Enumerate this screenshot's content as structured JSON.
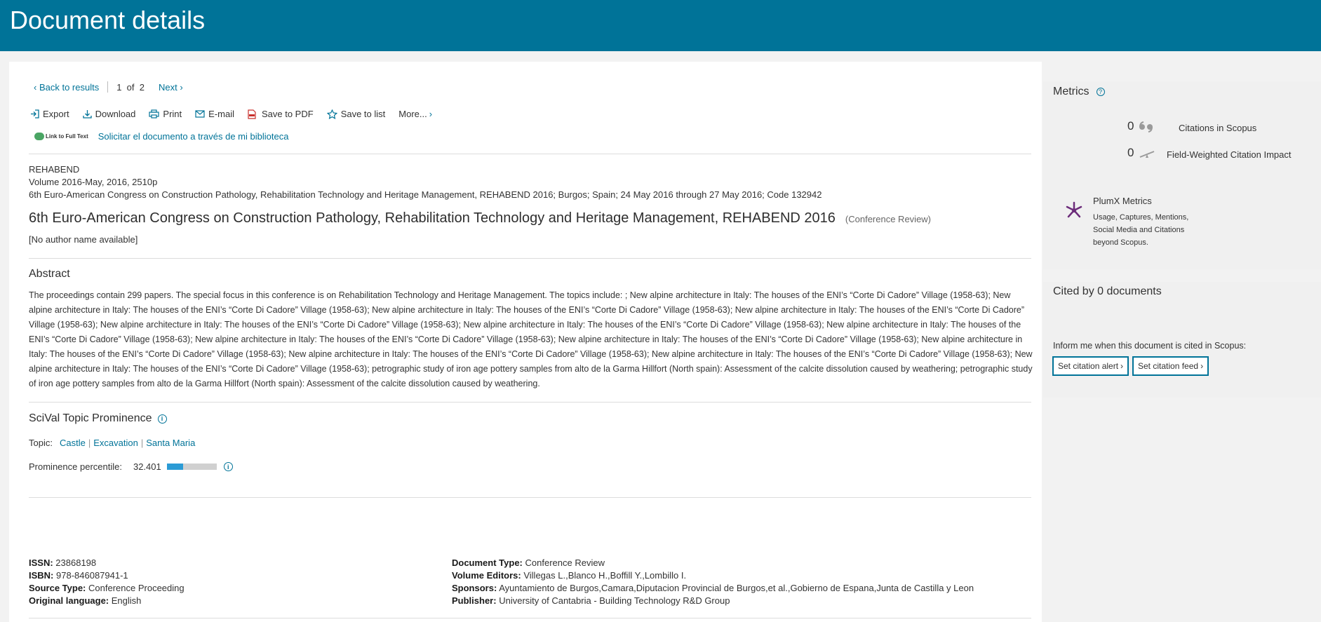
{
  "header": {
    "title": "Document details"
  },
  "nav": {
    "back": "Back to results",
    "pager": "1  of  2",
    "next": "Next"
  },
  "toolbar": {
    "export": "Export",
    "download": "Download",
    "print": "Print",
    "email": "E-mail",
    "pdf": "Save to PDF",
    "save_list": "Save to list",
    "more": "More..."
  },
  "linkrow": {
    "sfx_badge": "Link to Full Text",
    "library_link": "Solicitar el documento a través de mi biblioteca"
  },
  "source": {
    "journal": "REHABEND",
    "volume": "Volume 2016-May, 2016, 2510p",
    "conference": "6th Euro-American Congress on Construction Pathology, Rehabilitation Technology and Heritage Management, REHABEND 2016; Burgos; Spain; 24 May 2016 through 27 May 2016; Code 132942"
  },
  "document": {
    "title": "6th Euro-American Congress on Construction Pathology, Rehabilitation Technology and Heritage Management, REHABEND 2016",
    "type": "(Conference Review)",
    "authors": "[No author name available]"
  },
  "abstract": {
    "heading": "Abstract",
    "text": "The proceedings contain 299 papers. The special focus in this conference is on Rehabilitation Technology and Heritage Management. The topics include: ; New alpine architecture in Italy: The houses of the ENI’s “Corte Di Cadore” Village (1958-63); New alpine architecture in Italy: The houses of the ENI’s “Corte Di Cadore” Village (1958-63); New alpine architecture in Italy: The houses of the ENI’s “Corte Di Cadore” Village (1958-63); New alpine architecture in Italy: The houses of the ENI’s “Corte Di Cadore” Village (1958-63); New alpine architecture in Italy: The houses of the ENI’s “Corte Di Cadore” Village (1958-63); New alpine architecture in Italy: The houses of the ENI’s “Corte Di Cadore” Village (1958-63); New alpine architecture in Italy: The houses of the ENI’s “Corte Di Cadore” Village (1958-63); New alpine architecture in Italy: The houses of the ENI’s “Corte Di Cadore” Village (1958-63); New alpine architecture in Italy: The houses of the ENI’s “Corte Di Cadore” Village (1958-63); New alpine architecture in Italy: The houses of the ENI’s “Corte Di Cadore” Village (1958-63); New alpine architecture in Italy: The houses of the ENI’s “Corte Di Cadore” Village (1958-63); New alpine architecture in Italy: The houses of the ENI’s “Corte Di Cadore” Village (1958-63); New alpine architecture in Italy: The houses of the ENI’s “Corte Di Cadore” Village (1958-63); petrographic study of iron age pottery samples from alto de la Garma Hillfort (North spain): Assessment of the calcite dissolution caused by weathering; petrographic study of iron age pottery samples from alto de la Garma Hillfort (North spain): Assessment of the calcite dissolution caused by weathering."
  },
  "scival": {
    "heading": "SciVal Topic Prominence",
    "topic_label": "Topic:",
    "topics": [
      "Castle",
      "Excavation",
      "Santa Maria"
    ],
    "prominence_label": "Prominence percentile:",
    "prominence_value": "32.401",
    "prominence_fraction": 0.324
  },
  "biblio": {
    "issn_label": "ISSN:",
    "issn": "23868198",
    "isbn_label": "ISBN:",
    "isbn": "978-846087941-1",
    "source_type_label": "Source Type:",
    "source_type": "Conference Proceeding",
    "language_label": "Original language:",
    "language": "English",
    "doc_type_label": "Document Type:",
    "doc_type": "Conference Review",
    "editors_label": "Volume Editors:",
    "editors": "Villegas L.,Blanco H.,Boffill Y.,Lombillo I.",
    "sponsors_label": "Sponsors:",
    "sponsors": "Ayuntamiento de Burgos,Camara,Diputacion Provincial de Burgos,et al.,Gobierno de Espana,Junta de Castilla y Leon",
    "publisher_label": "Publisher:",
    "publisher": "University of Cantabria - Building Technology R&D Group"
  },
  "metrics": {
    "heading": "Metrics",
    "citations_value": "0",
    "citations_label": "Citations in Scopus",
    "fwci_value": "0",
    "fwci_label": "Field-Weighted Citation Impact",
    "plumx_title": "PlumX Metrics",
    "plumx_desc": [
      "Usage, Captures, Mentions,",
      "Social Media and Citations",
      "beyond Scopus."
    ]
  },
  "cited_by": {
    "heading": "Cited by 0 documents",
    "inform": "Inform me when this document is cited in Scopus:",
    "alert_btn": "Set citation alert",
    "feed_btn": "Set citation feed"
  },
  "colors": {
    "brand": "#007398",
    "plumx": "#6c2c7a",
    "prominence_fill": "#2b9bd5"
  }
}
